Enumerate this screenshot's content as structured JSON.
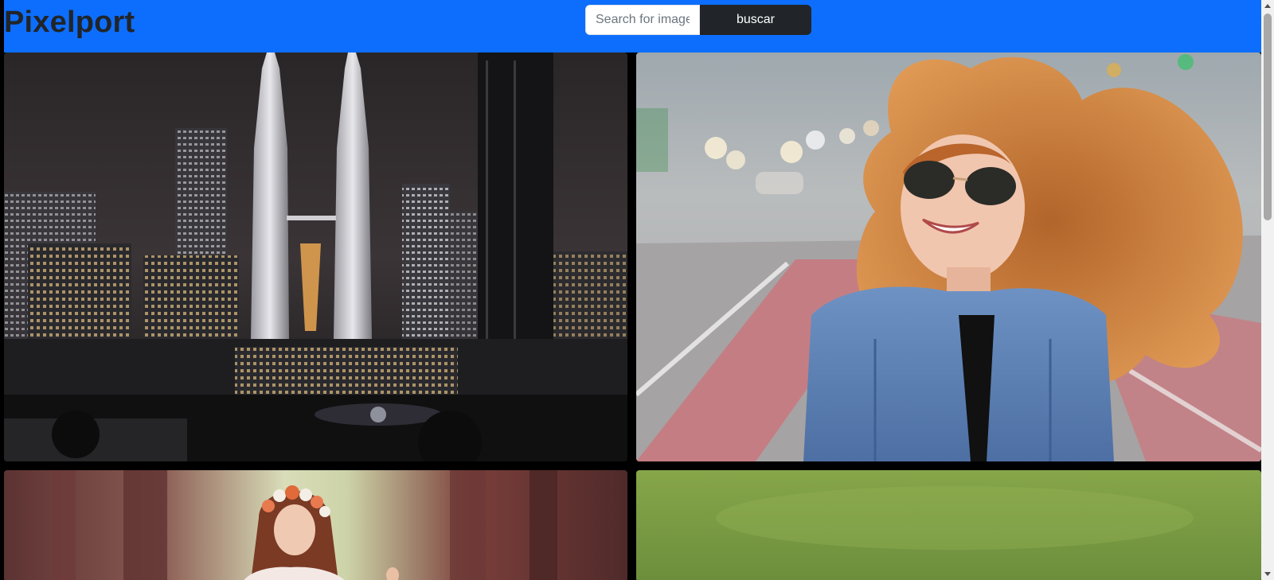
{
  "navbar": {
    "brand": "Pixelport",
    "search": {
      "placeholder": "Search for images",
      "value": "",
      "button_label": "buscar"
    },
    "background_color": "#0d6efd"
  },
  "gallery": {
    "images": [
      {
        "subject": "city-skyline-night-twin-towers"
      },
      {
        "subject": "woman-sunglasses-windblown-hair-street"
      },
      {
        "subject": "woman-flower-crown-forest"
      },
      {
        "subject": "green-grass-blur"
      }
    ]
  },
  "scrollbar": {
    "scroll_fraction": 0.0,
    "visible_fraction": 0.36
  }
}
